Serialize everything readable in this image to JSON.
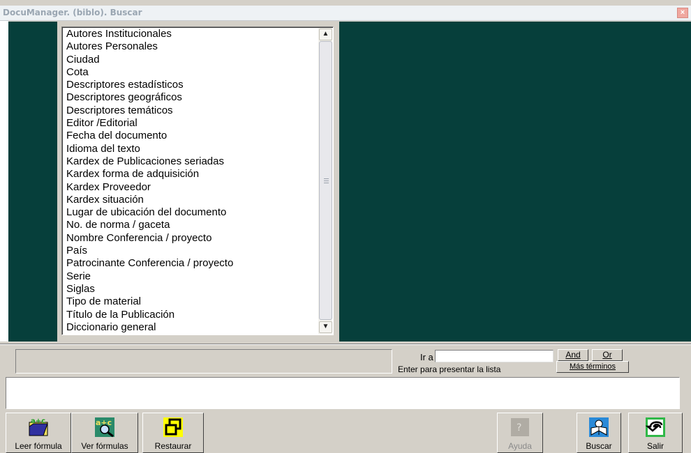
{
  "window": {
    "title": "DocuManager. (biblo). Buscar",
    "close_glyph": "×"
  },
  "field_list": {
    "items": [
      "Autores Institucionales",
      "Autores Personales",
      "Ciudad",
      "Cota",
      "Descriptores estadísticos",
      "Descriptores geográficos",
      "Descriptores temáticos",
      "Editor /Editorial",
      "Fecha del documento",
      "Idioma del texto",
      "Kardex de Publicaciones seriadas",
      "Kardex forma de adquisición",
      "Kardex Proveedor",
      "Kardex situación",
      "Lugar de ubicación del documento",
      "No. de norma / gaceta",
      "Nombre Conferencia / proyecto",
      "País",
      "Patrocinante Conferencia / proyecto",
      "Serie",
      "Siglas",
      "Tipo de material",
      "Título de la Publicación",
      "Diccionario general"
    ],
    "scroll_up_glyph": "▲",
    "scroll_down_glyph": "▼"
  },
  "search": {
    "goto_label": "Ir a",
    "goto_value": "",
    "hint": "Enter para presentar la lista",
    "and_label": "And",
    "or_label": "Or",
    "more_terms_label": "Más términos"
  },
  "toolbar": {
    "leer_formula": "Leer fórmula",
    "ver_formulas": "Ver fórmulas",
    "restaurar": "Restaurar",
    "ayuda": "Ayuda",
    "buscar": "Buscar",
    "salir": "Salir"
  },
  "icons": {
    "leer_formula": "abc-folder-icon",
    "ver_formulas": "abc-magnifier-icon",
    "restaurar": "restore-window-icon",
    "ayuda": "help-icon",
    "buscar": "reader-book-icon",
    "salir": "exit-arrow-icon"
  }
}
